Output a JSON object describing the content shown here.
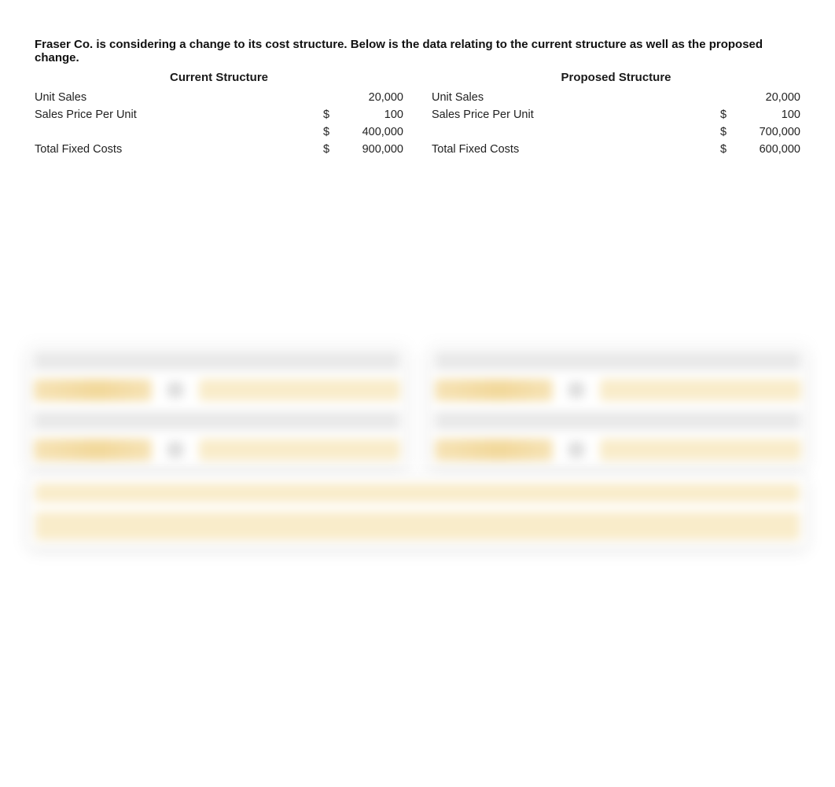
{
  "intro": "Fraser Co. is considering a change to its cost structure.  Below is the data relating to the current structure as well as the proposed change.",
  "current": {
    "title": "Current Structure",
    "rows": [
      {
        "label": "Unit Sales",
        "currency": "",
        "value": "20,000"
      },
      {
        "label": "Sales Price Per Unit",
        "currency": "$",
        "value": "100"
      },
      {
        "label": "",
        "currency": "$",
        "value": "400,000"
      },
      {
        "label": "Total Fixed Costs",
        "currency": "$",
        "value": "900,000"
      }
    ]
  },
  "proposed": {
    "title": "Proposed Structure",
    "rows": [
      {
        "label": "Unit Sales",
        "currency": "",
        "value": "20,000"
      },
      {
        "label": "Sales Price Per Unit",
        "currency": "$",
        "value": "100"
      },
      {
        "label": "",
        "currency": "$",
        "value": "700,000"
      },
      {
        "label": "Total Fixed Costs",
        "currency": "$",
        "value": "600,000"
      }
    ]
  }
}
